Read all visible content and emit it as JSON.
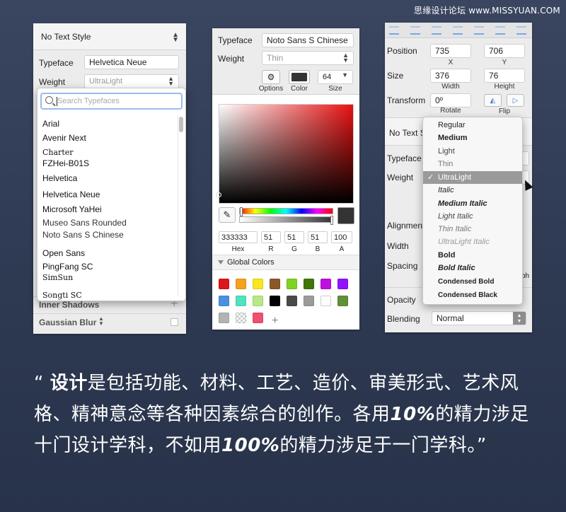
{
  "watermark": "思缘设计论坛 www.MISSYUAN.COM",
  "panel1": {
    "text_style": "No Text Style",
    "typeface_label": "Typeface",
    "typeface_value": "Helvetica Neue",
    "weight_label": "Weight",
    "weight_value": "UltraLight",
    "search_placeholder": "Search Typefaces",
    "fonts": [
      "Arial",
      "Avenir Next",
      "Charter",
      "FZHei-B01S",
      "Helvetica",
      "Helvetica Neue",
      "Microsoft YaHei",
      "Museo Sans Rounded",
      "Noto Sans S Chinese",
      "Open Sans",
      "PingFang SC",
      "SimSun",
      "Songti SC"
    ],
    "inner_shadows": "Inner Shadows",
    "gaussian_blur": "Gaussian Blur",
    "plus": "+"
  },
  "panel2": {
    "typeface_label": "Typeface",
    "typeface_value": "Noto Sans S Chinese",
    "weight_label": "Weight",
    "weight_value": "Thin",
    "options_label": "Options",
    "color_label": "Color",
    "size_label": "Size",
    "size_value": "64",
    "hex_value": "333333",
    "r_value": "51",
    "g_value": "51",
    "b_value": "51",
    "a_value": "100",
    "hex_label": "Hex",
    "r_label": "R",
    "g_label": "G",
    "b_label": "B",
    "a_label": "A",
    "global_colors": "Global Colors",
    "plus": "+",
    "swatches": [
      "#e0141e",
      "#f5a11c",
      "#f8e71c",
      "#8b572a",
      "#7ed321",
      "#417505",
      "#bd10e0",
      "#9013fe",
      "#4a90e2",
      "#50e3c2",
      "#b8e986",
      "#000000",
      "#4a4a4a",
      "#9b9b9b",
      "#ffffff",
      "#62903a",
      "#b3b3b3",
      "transparent",
      "#f0506e"
    ],
    "current_color": "#333333"
  },
  "panel3": {
    "position_label": "Position",
    "x_value": "735",
    "y_value": "706",
    "x_label": "X",
    "y_label": "Y",
    "size_label": "Size",
    "width_value": "376",
    "height_value": "76",
    "width_sub": "Width",
    "height_sub": "Height",
    "transform_label": "Transform",
    "rotate_value": "0º",
    "rotate_label": "Rotate",
    "flip_label": "Flip",
    "text_style": "No Text S",
    "typeface_label": "Typeface",
    "weight_label": "Weight",
    "alignment_label": "Alignment",
    "width_label": "Width",
    "spacing_label": "Spacing",
    "ph_fragment": "ph",
    "opacity_label": "Opacity",
    "blending_label": "Blending",
    "blending_value": "Normal",
    "menu": [
      "Regular",
      "Medium",
      "Light",
      "Thin",
      "UltraLight",
      "Italic",
      "Medium Italic",
      "Light Italic",
      "Thin Italic",
      "UltraLight Italic",
      "Bold",
      "Bold Italic",
      "Condensed Bold",
      "Condensed Black"
    ],
    "menu_selected": "UltraLight",
    "check": "✓"
  },
  "quote": {
    "open": "“ ",
    "bold1": "设计",
    "t1": "是包括功能、材料、工艺、造价、审美形式、艺术风格、精神意念等各种因素综合的创作。各用",
    "n1": "10%",
    "t2": "的精力涉足十门设计学科，不如用",
    "n2": "100%",
    "t3": "的精力涉足于一门学科。",
    "close": "”"
  }
}
